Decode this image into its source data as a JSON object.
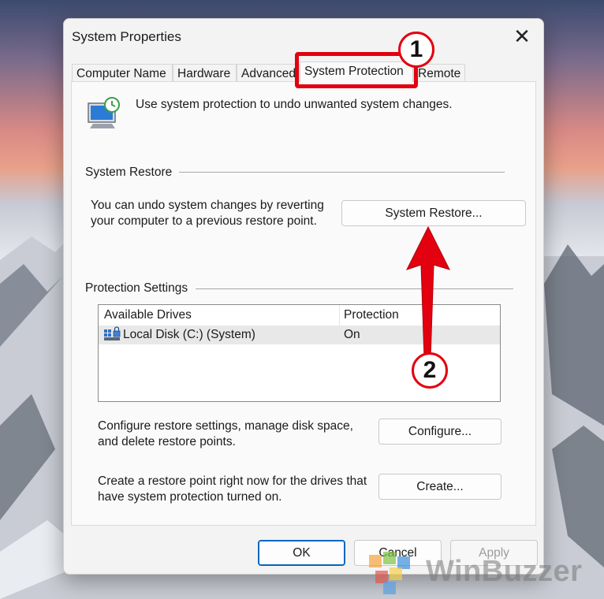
{
  "window": {
    "title": "System Properties",
    "close_glyph": "✕"
  },
  "tabs": [
    {
      "label": "Computer Name"
    },
    {
      "label": "Hardware"
    },
    {
      "label": "Advanced"
    },
    {
      "label": "System Protection",
      "active": true
    },
    {
      "label": "Remote"
    }
  ],
  "header": {
    "description": "Use system protection to undo unwanted system changes.",
    "icon": "system-protection-icon"
  },
  "system_restore": {
    "section_label": "System Restore",
    "line1": "You can undo system changes by reverting",
    "line2": "your computer to a previous restore point.",
    "button": "System Restore..."
  },
  "protection_settings": {
    "section_label": "Protection Settings",
    "columns": [
      "Available Drives",
      "Protection"
    ],
    "drives": [
      {
        "name": "Local Disk (C:) (System)",
        "protection": "On",
        "icon": "drive-icon"
      }
    ]
  },
  "configure": {
    "line1": "Configure restore settings, manage disk space,",
    "line2": "and delete restore points.",
    "button": "Configure..."
  },
  "create": {
    "line1": "Create a restore point right now for the drives that",
    "line2": "have system protection turned on.",
    "button": "Create..."
  },
  "footer": {
    "ok": "OK",
    "cancel": "Cancel",
    "apply": "Apply"
  },
  "annotations": {
    "step1": "1",
    "step2": "2",
    "color": "#e3000f"
  },
  "watermark": {
    "text": "WinBuzzer"
  }
}
